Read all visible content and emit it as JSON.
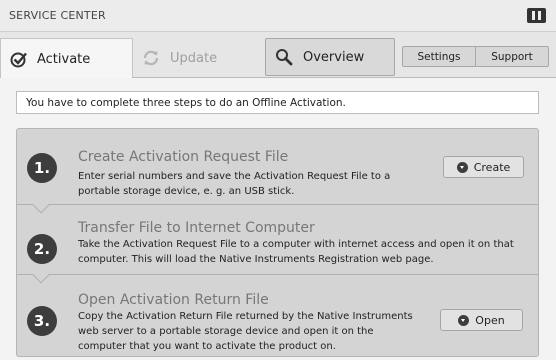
{
  "window": {
    "title": "SERVICE CENTER",
    "logo_icon": "ni-logo-icon"
  },
  "tabs": [
    {
      "label": "Activate",
      "icon": "checkmark-icon",
      "state": "selected"
    },
    {
      "label": "Update",
      "icon": "refresh-icon",
      "state": "disabled"
    },
    {
      "label": "Overview",
      "icon": "magnifier-icon",
      "state": "normal"
    }
  ],
  "header_buttons": {
    "settings": "Settings",
    "support": "Support"
  },
  "notice": "You have to complete three steps to do an Offline Activation.",
  "steps": [
    {
      "number": "1.",
      "title": "Create Activation Request File",
      "description": "Enter serial numbers and save the Activation Request File to a portable storage device, e. g. an USB stick.",
      "button": "Create"
    },
    {
      "number": "2.",
      "title": "Transfer File to Internet Computer",
      "description": "Take the Activation Request File to a computer with internet access and open it on that computer. This will load the Native Instruments Registration web page."
    },
    {
      "number": "3.",
      "title": "Open Activation Return File",
      "description": "Copy the Activation Return File returned by the Native Instruments web server to a portable storage device and open it on the computer that you want to activate the product on.",
      "button": "Open"
    }
  ],
  "colors": {
    "accent_dark": "#3d3d3d",
    "step_panel": "#d4d4d4",
    "disabled_text": "#a0a0a0"
  }
}
